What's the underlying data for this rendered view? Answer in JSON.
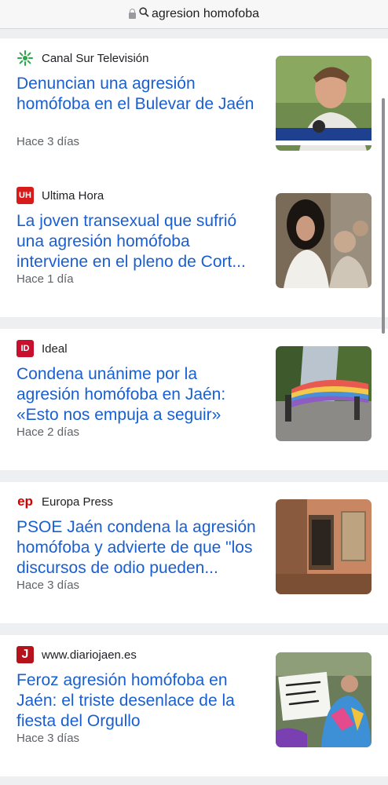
{
  "search": {
    "query": "agresion homofoba"
  },
  "articles": [
    {
      "source": "Canal Sur Televisión",
      "title": "Denuncian una agresión homófoba en el Bulevar de Jaén",
      "age": "Hace 3 días",
      "logo_icon": "green-star-icon"
    },
    {
      "source": "Ultima Hora",
      "title": "La joven transexual que sufrió una agresión homófoba interviene en el pleno de Cort...",
      "age": "Hace 1 día",
      "logo_text": "UH"
    },
    {
      "source": "Ideal",
      "title": "Condena unánime por la agresión homófoba en Jaén: «Esto nos empuja a seguir»",
      "age": "Hace 2 días",
      "logo_text": "ID"
    },
    {
      "source": "Europa Press",
      "title": "PSOE Jaén condena la agresión homófoba y advierte de que \"los discursos de odio pueden...",
      "age": "Hace 3 días",
      "logo_text": "ep"
    },
    {
      "source": "www.diariojaen.es",
      "title": "Feroz agresión homófoba en Jaén: el triste desenlace de la fiesta del Orgullo",
      "age": "Hace 3 días",
      "logo_text": "J"
    }
  ],
  "colors": {
    "link": "#1a5fd0",
    "meta": "#5f6368",
    "separator": "#eeeff1"
  }
}
